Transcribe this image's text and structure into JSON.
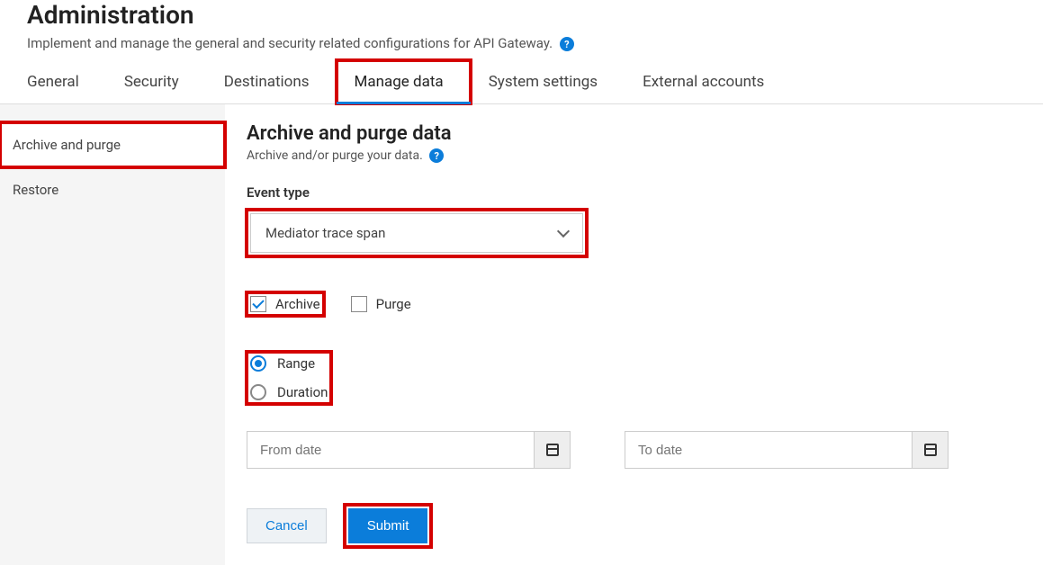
{
  "header": {
    "title": "Administration",
    "subtitle": "Implement and manage the general and security related configurations for API Gateway."
  },
  "tabs": [
    {
      "label": "General"
    },
    {
      "label": "Security"
    },
    {
      "label": "Destinations"
    },
    {
      "label": "Manage data",
      "active": true
    },
    {
      "label": "System settings"
    },
    {
      "label": "External accounts"
    }
  ],
  "sidebar": [
    {
      "label": "Archive and purge",
      "active": true
    },
    {
      "label": "Restore"
    }
  ],
  "section": {
    "title": "Archive and purge data",
    "subtitle": "Archive and/or purge your data."
  },
  "event_type": {
    "label": "Event type",
    "selected": "Mediator trace span"
  },
  "actions": {
    "archive": {
      "label": "Archive",
      "checked": true
    },
    "purge": {
      "label": "Purge",
      "checked": false
    }
  },
  "mode": {
    "range": {
      "label": "Range",
      "selected": true
    },
    "duration": {
      "label": "Duration",
      "selected": false
    }
  },
  "dates": {
    "from_placeholder": "From date",
    "to_placeholder": "To date"
  },
  "buttons": {
    "cancel": "Cancel",
    "submit": "Submit"
  }
}
